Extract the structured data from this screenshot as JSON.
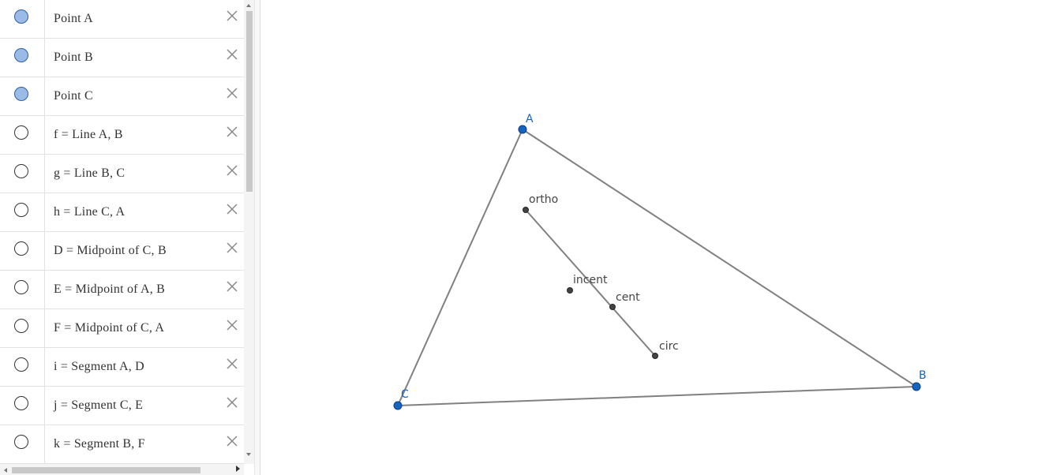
{
  "algebra_view": {
    "rows": [
      {
        "text": "Point A",
        "visible": true
      },
      {
        "text": "Point B",
        "visible": true
      },
      {
        "text": "Point C",
        "visible": true
      },
      {
        "text": "f = Line A, B",
        "visible": false
      },
      {
        "text": "g = Line B, C",
        "visible": false
      },
      {
        "text": "h = Line C, A",
        "visible": false
      },
      {
        "text": "D = Midpoint of C, B",
        "visible": false
      },
      {
        "text": "E = Midpoint of A, B",
        "visible": false
      },
      {
        "text": "F = Midpoint of C, A",
        "visible": false
      },
      {
        "text": "i = Segment A, D",
        "visible": false
      },
      {
        "text": "j = Segment C, E",
        "visible": false
      },
      {
        "text": "k = Segment B, F",
        "visible": false
      }
    ],
    "delete_icon": "close-icon"
  },
  "graphics": {
    "colors": {
      "free_point": "#1565c0",
      "free_point_label": "#1565c0",
      "dependent_point": "#444444",
      "dependent_label": "#444444",
      "segment": "#808080"
    },
    "points": {
      "A": {
        "label": "A"
      },
      "B": {
        "label": "B"
      },
      "C": {
        "label": "C"
      },
      "ortho": {
        "label": "ortho"
      },
      "incent": {
        "label": "incent"
      },
      "cent": {
        "label": "cent"
      },
      "circ": {
        "label": "circ"
      }
    }
  }
}
